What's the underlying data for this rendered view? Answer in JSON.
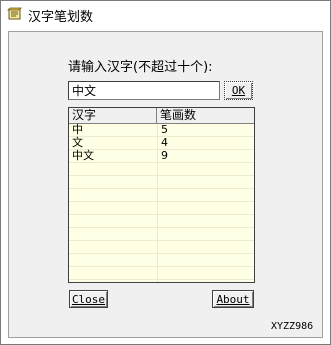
{
  "window": {
    "title": "汉字笔划数"
  },
  "prompt": "请输入汉字(不超过十个):",
  "input": {
    "value": "中文"
  },
  "buttons": {
    "ok": "OK",
    "close": "Close",
    "about": "About"
  },
  "table": {
    "headers": [
      "汉字",
      "笔画数"
    ],
    "rows": [
      {
        "char": "中",
        "strokes": "5"
      },
      {
        "char": "文",
        "strokes": "4"
      },
      {
        "char": "中文",
        "strokes": "9"
      }
    ]
  },
  "footer": "XYZZ986",
  "colors": {
    "list_bg": "#ffffe6",
    "dialog_bg": "#f0f0f0"
  },
  "icons": {
    "app": "notepad-icon"
  }
}
